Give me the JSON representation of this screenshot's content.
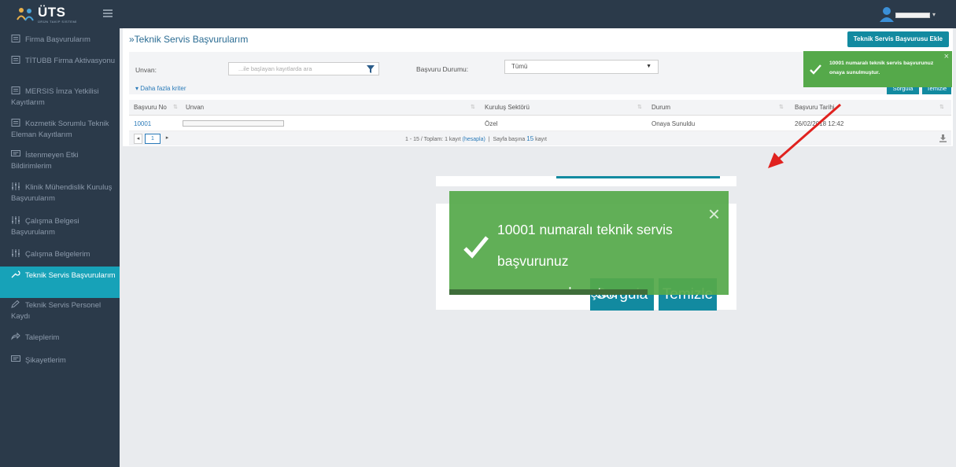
{
  "header": {
    "logo_text": "ÜTS",
    "logo_sub": "ÜRÜN TAKİP SİSTEMİ"
  },
  "sidebar": {
    "items": [
      {
        "label": "Firma Başvurularım",
        "icon": "document-icon"
      },
      {
        "label": "TİTUBB Firma Aktivasyonu",
        "icon": "document-icon"
      },
      {
        "label": "MERSIS İmza Yetkilisi Kayıtlarım",
        "icon": "document-icon"
      },
      {
        "label": "Kozmetik Sorumlu Teknik Eleman Kayıtlarım",
        "icon": "document-icon"
      },
      {
        "label": "İstenmeyen Etki Bildirimlerim",
        "icon": "chat-icon"
      },
      {
        "label": "Klinik Mühendislik Kuruluş Başvurularım",
        "icon": "sliders-icon"
      },
      {
        "label": "Çalışma Belgesi Başvurularım",
        "icon": "sliders-icon"
      },
      {
        "label": "Çalışma Belgelerim",
        "icon": "sliders-icon"
      },
      {
        "label": "Teknik Servis Başvurularım",
        "icon": "wrench-icon"
      },
      {
        "label": "Teknik Servis Personel Kaydı",
        "icon": "pencil-icon"
      },
      {
        "label": "Taleplerim",
        "icon": "reply-icon"
      },
      {
        "label": "Şikayetlerim",
        "icon": "chat-icon"
      }
    ],
    "active_index": 8
  },
  "main": {
    "title": "»Teknik Servis Başvurularım",
    "add_button": "Teknik Servis Başvurusu Ekle",
    "filters": {
      "unvan_label": "Unvan:",
      "unvan_placeholder": "...ile başlayan kayıtlarda ara",
      "durum_label": "Başvuru Durumu:",
      "durum_value": "Tümü",
      "more_link": "Daha fazla kriter",
      "search_button": "Sorgula",
      "clear_button": "Temizle"
    },
    "table": {
      "columns": [
        "Başvuru No",
        "Unvan",
        "Kuruluş Sektörü",
        "Durum",
        "Başvuru Tarihi"
      ],
      "rows": [
        {
          "no": "10001",
          "unvan": "",
          "sektor": "Özel",
          "durum": "Onaya Sunuldu",
          "tarih": "26/02/2018 12:42"
        }
      ]
    },
    "pager": {
      "current_page": "1",
      "range": "1 - 15 / Toplam: 1 kayıt",
      "calc_link": "(hesapla)",
      "per_page_label": "Sayfa başına",
      "per_page_value": "15",
      "per_page_suffix": "kayıt"
    }
  },
  "toast": {
    "message": "10001 numaralı teknik servis başvurunuz onaya sunulmuştur.",
    "message_line1": "10001 numaralı teknik servis başvurunuz",
    "message_line2": "onaya sunulmuştur.",
    "close": "×"
  },
  "zoom": {
    "search_button": "Sorgula",
    "clear_button": "Temizle"
  },
  "colors": {
    "sidebar_bg": "#2b3a4a",
    "accent": "#128aa0",
    "active_item": "#17a2b8",
    "toast_bg": "#55a94a",
    "arrow": "#e0221f"
  }
}
